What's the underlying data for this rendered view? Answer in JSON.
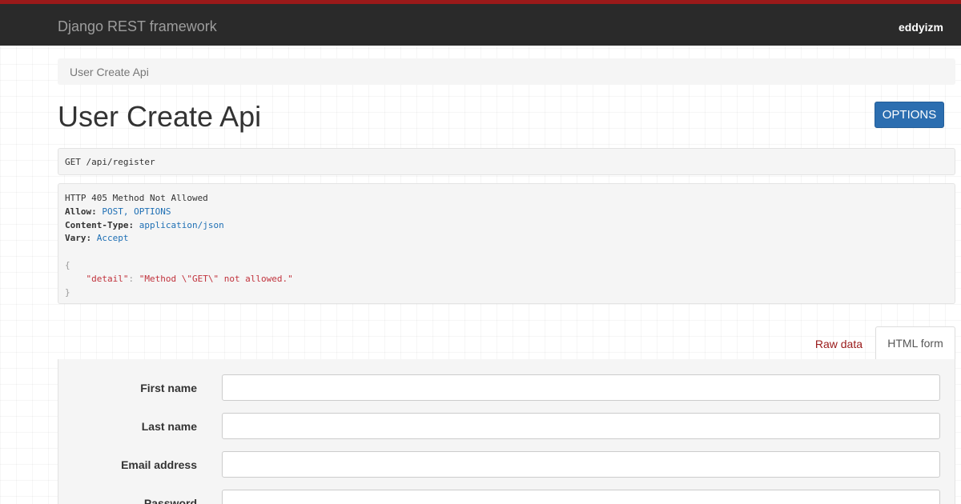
{
  "navbar": {
    "brand": "Django REST framework",
    "user": "eddyizm"
  },
  "breadcrumb": {
    "items": [
      "User Create Api"
    ]
  },
  "page": {
    "title": "User Create Api",
    "options_label": "OPTIONS"
  },
  "request": {
    "line": "GET /api/register"
  },
  "response": {
    "status_line": "HTTP 405 Method Not Allowed",
    "headers": [
      {
        "name": "Allow",
        "value": "POST, OPTIONS"
      },
      {
        "name": "Content-Type",
        "value": "application/json"
      },
      {
        "name": "Vary",
        "value": "Accept"
      }
    ],
    "body_open": "{",
    "body_key": "\"detail\"",
    "body_sep": ": ",
    "body_value": "\"Method \\\"GET\\\" not allowed.\"",
    "body_close": "}"
  },
  "tabs": {
    "raw_label": "Raw data",
    "html_label": "HTML form"
  },
  "form": {
    "fields": [
      {
        "label": "First name",
        "value": ""
      },
      {
        "label": "Last name",
        "value": ""
      },
      {
        "label": "Email address",
        "value": ""
      },
      {
        "label": "Password",
        "value": ""
      }
    ]
  },
  "colors": {
    "navbar_bg": "#2a2a2a",
    "navbar_accent": "#9a1a1a",
    "button_primary": "#2c6eb0",
    "header_value": "#1e6fb4",
    "json_string": "#c1323c"
  }
}
